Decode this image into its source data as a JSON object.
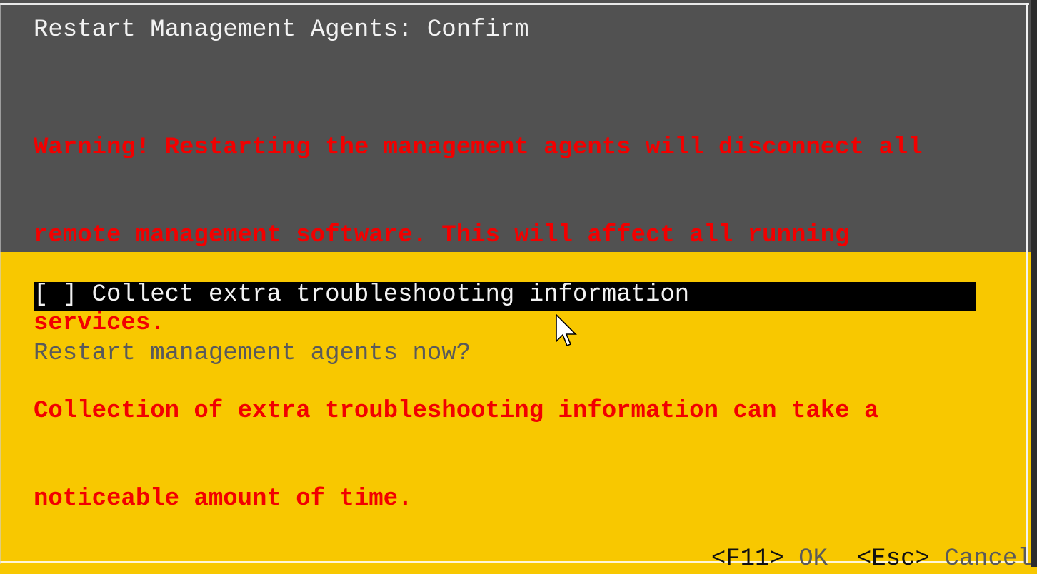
{
  "dialog": {
    "title": "Restart Management Agents: Confirm",
    "warning_lines": [
      "Warning! Restarting the management agents will disconnect all",
      "remote management software. This will affect all running",
      "services.",
      "Collection of extra troubleshooting information can take a",
      "noticeable amount of time."
    ],
    "option": {
      "checkbox": "[ ]",
      "checked": false,
      "label": "Collect extra troubleshooting information"
    },
    "prompt": "Restart management agents now?",
    "footer": {
      "ok_key": "<F11>",
      "ok_label": "OK",
      "cancel_key": "<Esc>",
      "cancel_label": "Cancel"
    }
  },
  "colors": {
    "header_bg": "#515151",
    "body_bg": "#f8c800",
    "warning": "#f20000",
    "title": "#f2f2f2",
    "highlight_bg": "#000000",
    "muted_text": "#5a5a5a"
  },
  "pointer": "mouse-cursor-arrow"
}
